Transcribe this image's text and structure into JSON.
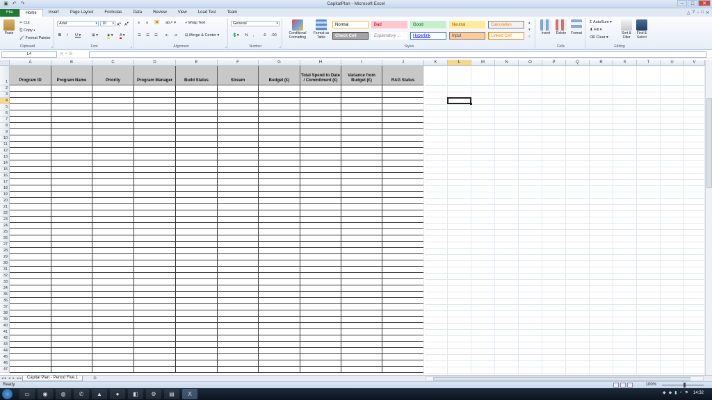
{
  "window": {
    "title": "CapitalPlan - Microsoft Excel",
    "qat_icons": [
      "save-icon",
      "undo-icon",
      "redo-icon"
    ]
  },
  "ribbon": {
    "tabs": [
      "File",
      "Home",
      "Insert",
      "Page Layout",
      "Formulas",
      "Data",
      "Review",
      "View",
      "Load Test",
      "Team"
    ],
    "active_tab": "Home",
    "clipboard": {
      "paste": "Paste",
      "cut": "Cut",
      "copy": "Copy",
      "format_painter": "Format Painter",
      "group": "Clipboard"
    },
    "font": {
      "name": "Arial",
      "size": "10",
      "group": "Font"
    },
    "alignment": {
      "wrap_text": "Wrap Text",
      "merge_center": "Merge & Center",
      "group": "Alignment"
    },
    "number": {
      "format": "General",
      "group": "Number"
    },
    "styles": {
      "conditional_formatting": "Conditional Formatting",
      "format_as_table": "Format as Table",
      "cells": [
        {
          "label": "Normal",
          "bg": "#ffffff",
          "fg": "#000000",
          "border": "#f0c040"
        },
        {
          "label": "Bad",
          "bg": "#ffc7ce",
          "fg": "#9c0006",
          "border": "#ffc7ce"
        },
        {
          "label": "Good",
          "bg": "#c6efce",
          "fg": "#006100",
          "border": "#c6efce"
        },
        {
          "label": "Neutral",
          "bg": "#ffeb9c",
          "fg": "#9c5700",
          "border": "#ffeb9c"
        },
        {
          "label": "Calculation",
          "bg": "#f2f2f2",
          "fg": "#fa7d00",
          "border": "#7f7f7f"
        },
        {
          "label": "Check Cell",
          "bg": "#a5a5a5",
          "fg": "#ffffff",
          "border": "#3f3f3f"
        },
        {
          "label": "Explanatory ...",
          "bg": "#ffffff",
          "fg": "#7f7f7f",
          "border": "#ffffff"
        },
        {
          "label": "Hyperlink",
          "bg": "#ffffff",
          "fg": "#0000ff",
          "border": "#4472c4"
        },
        {
          "label": "Input",
          "bg": "#ffcc99",
          "fg": "#3f3f76",
          "border": "#7f7f7f"
        },
        {
          "label": "Linked Cell",
          "bg": "#ffffff",
          "fg": "#fa7d00",
          "border": "#ff8001"
        }
      ],
      "group": "Styles"
    },
    "cells": {
      "insert": "Insert",
      "delete": "Delete",
      "format": "Format",
      "group": "Cells"
    },
    "editing": {
      "autosum": "AutoSum",
      "fill": "Fill",
      "clear": "Clear",
      "sort_filter": "Sort & Filter",
      "find_select": "Find & Select",
      "group": "Editing"
    }
  },
  "formula_bar": {
    "name_box": "L4",
    "value": ""
  },
  "grid": {
    "columns": [
      "A",
      "B",
      "C",
      "D",
      "E",
      "F",
      "G",
      "H",
      "I",
      "J",
      "K",
      "L",
      "M",
      "N",
      "O",
      "P",
      "Q",
      "R",
      "S",
      "T",
      "U",
      "V"
    ],
    "selected_column": "L",
    "selected_row": 4,
    "row_count": 47,
    "table_headers": [
      "Program ID",
      "Program Name",
      "Priority",
      "Program Manager",
      "Build Status",
      "Stream",
      "Budget (£)",
      "Total Spend to Date / Commitment (£)",
      "Variance from Budget (£)",
      "RAG Status"
    ],
    "header_bg": "#c8c8c8"
  },
  "sheet_tabs": [
    "Capital Plan - Period Five.1"
  ],
  "status": {
    "ready": "Ready",
    "zoom": "100%"
  },
  "taskbar": {
    "clock": "14:32"
  }
}
